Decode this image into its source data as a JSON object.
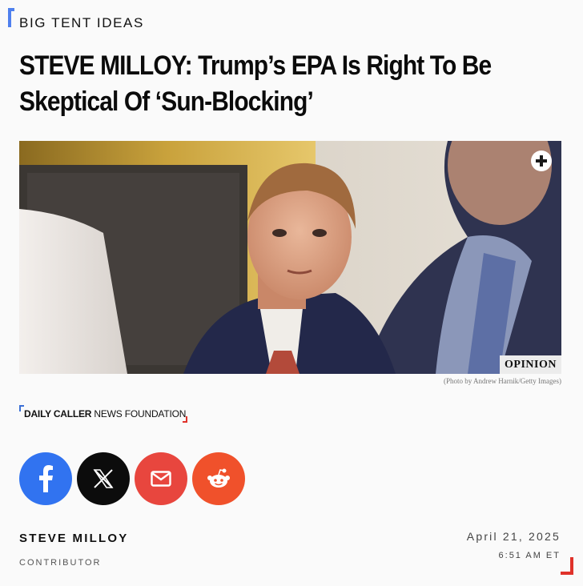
{
  "category": {
    "label": "BIG TENT IDEAS"
  },
  "headline": {
    "line1": "STEVE MILLOY: Trump’s EPA Is Right To Be",
    "line2": "Skeptical Of ‘Sun-Blocking’"
  },
  "hero": {
    "tag": "OPINION",
    "credit": "(Photo by Andrew Harnik/Getty Images)"
  },
  "source": {
    "bold": "DAILY CALLER",
    "rest": " NEWS FOUNDATION"
  },
  "share": {
    "icons": [
      "facebook-icon",
      "x-icon",
      "mail-icon",
      "reddit-icon"
    ]
  },
  "byline": {
    "name": "STEVE MILLOY",
    "role": "CONTRIBUTOR",
    "date": "April 21, 2025",
    "time": "6:51 AM ET"
  },
  "colors": {
    "accent_blue": "#4f80ee",
    "accent_red": "#e0322a",
    "facebook": "#3173f0",
    "x": "#0c0c0c",
    "mail": "#e8463e",
    "reddit": "#f0512b"
  }
}
